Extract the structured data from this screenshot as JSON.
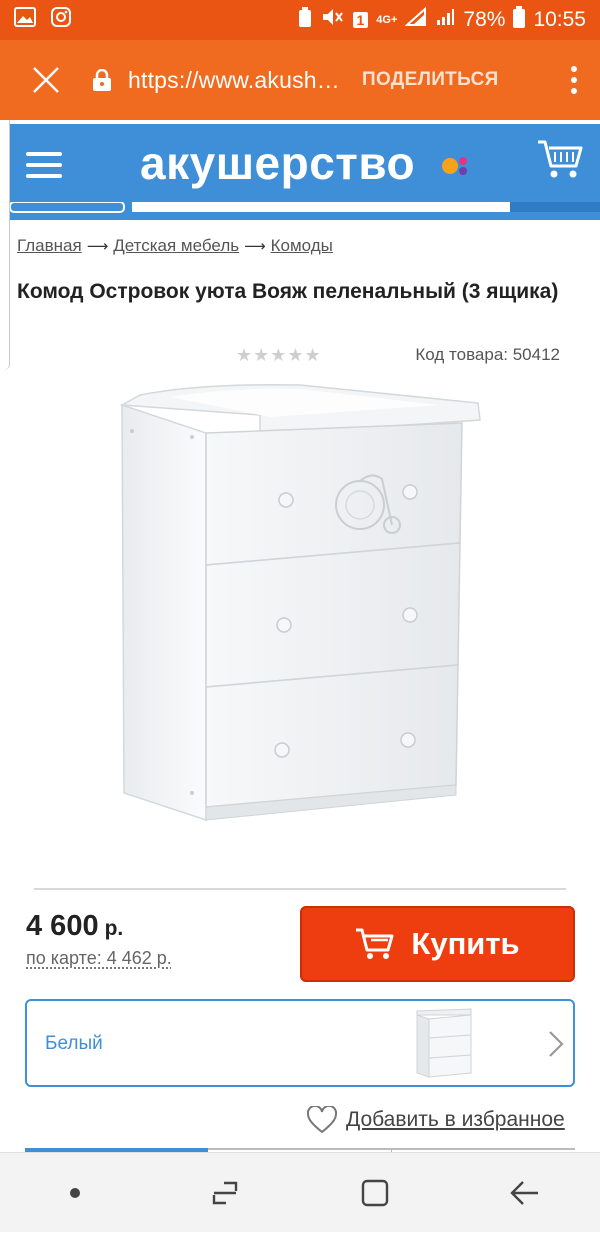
{
  "statusbar": {
    "battery": "78%",
    "time": "10:55",
    "network": "4G+",
    "sim_slot": "1"
  },
  "browser": {
    "url": "https://www.akush…",
    "share_label": "ПОДЕЛИТЬСЯ",
    "bar_color": "#f06a1f"
  },
  "site": {
    "logo_text": "акушерство",
    "header_color": "#3f8fd8"
  },
  "breadcrumbs": [
    "Главная",
    "Детская мебель",
    "Комоды"
  ],
  "breadcrumb_separator": "⟶",
  "product": {
    "title": "Комод Островок уюта Вояж пеленальный (3 ящика)",
    "rating_stars": "★★★★★",
    "rating_value": 0,
    "code_label": "Код товара: 50412",
    "price": "4 600",
    "currency": "р.",
    "card_price": "по карте: 4 462 р.",
    "buy_label": "Купить",
    "buy_color": "#ee3d0e",
    "variant_label": "Белый",
    "favorite_label": "Добавить в избранное"
  }
}
